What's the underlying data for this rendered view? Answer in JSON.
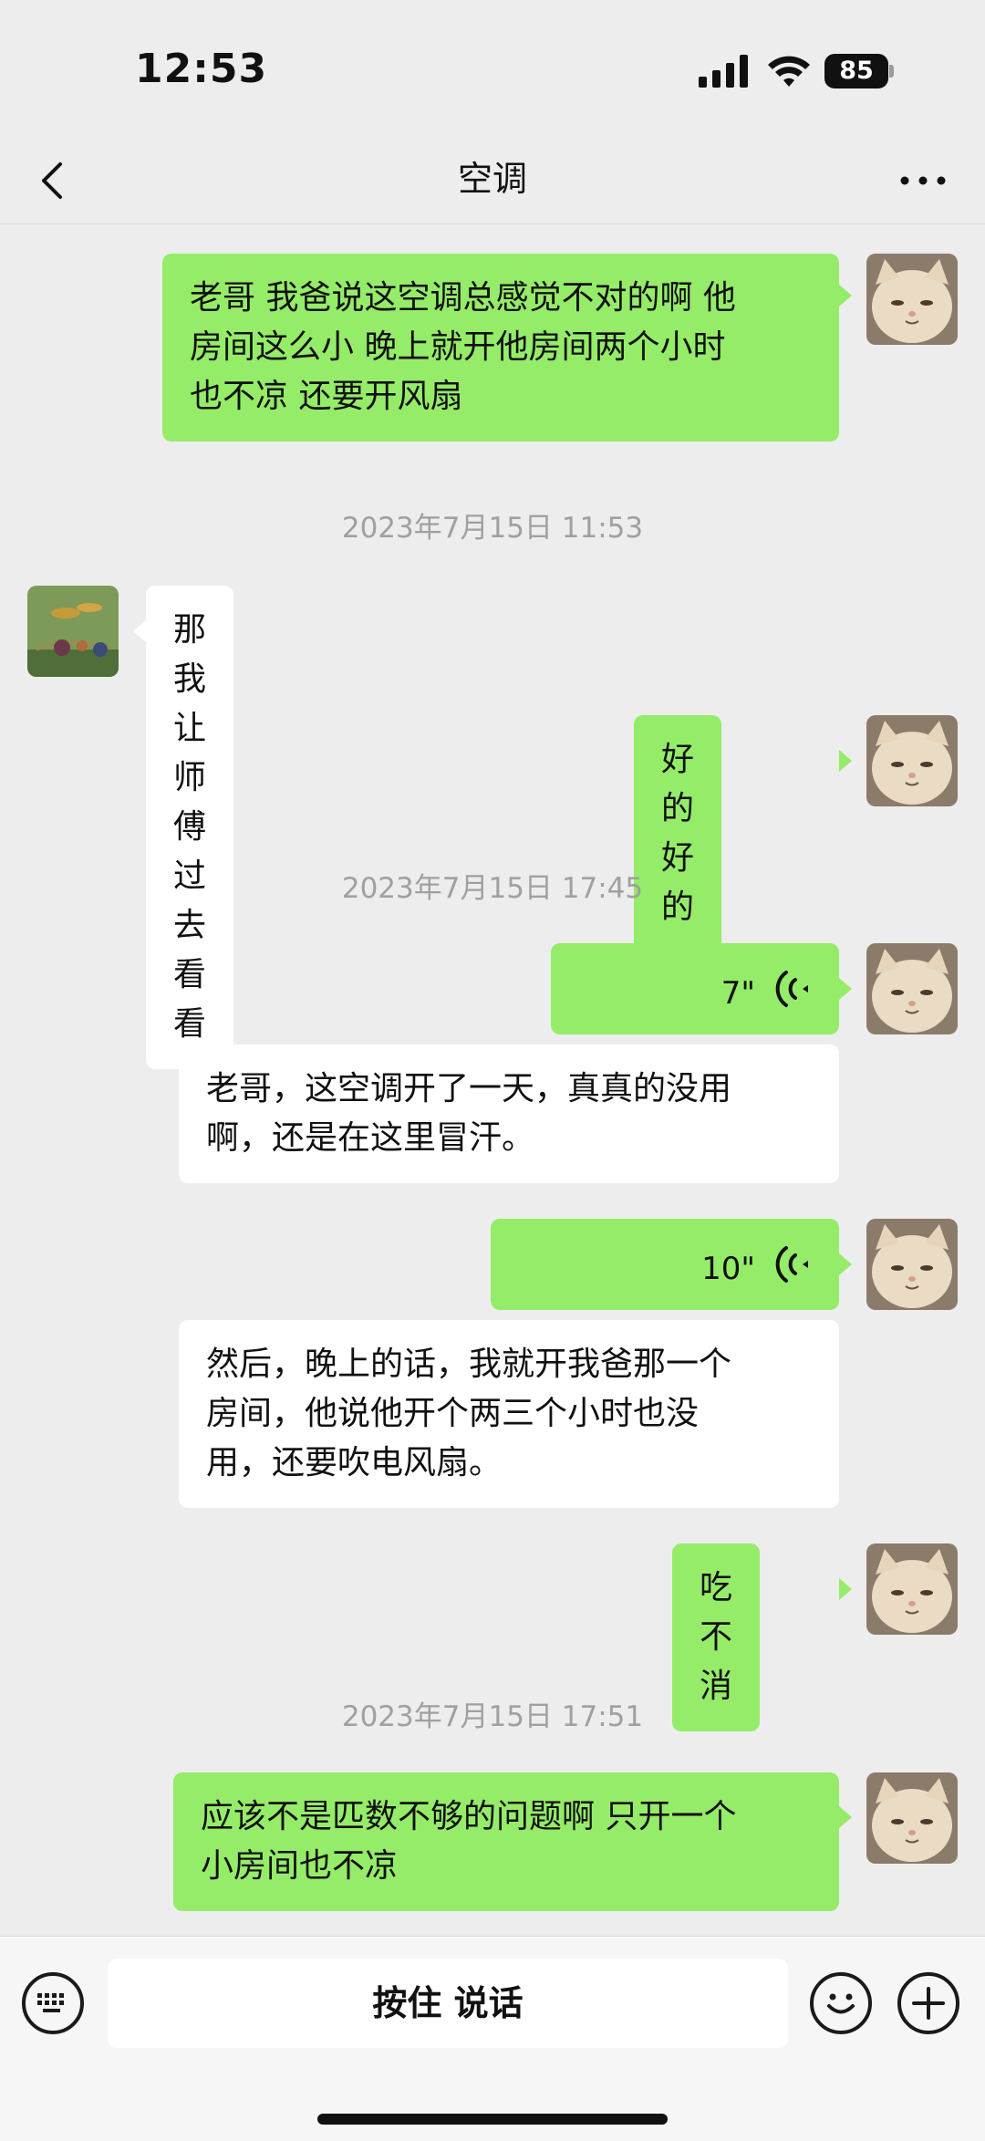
{
  "status_bar": {
    "time": "12:53",
    "battery": "85"
  },
  "nav": {
    "title": "空调",
    "back_icon": "chevron-left-icon",
    "more_icon": "more-dots-icon"
  },
  "messages": [
    {
      "type": "text",
      "side": "right",
      "lines": [
        "老哥 我爸说这空调总感觉不对的啊 他",
        "房间这么小 晚上就开他房间两个小时",
        "也不凉 还要开风扇"
      ]
    },
    {
      "type": "timestamp",
      "text": "2023年7月15日 11:53"
    },
    {
      "type": "text",
      "side": "left",
      "lines": [
        "那我让师傅过去看看"
      ]
    },
    {
      "type": "text",
      "side": "right",
      "lines": [
        "好的好的"
      ]
    },
    {
      "type": "timestamp",
      "text": "2023年7月15日 17:45"
    },
    {
      "type": "voice",
      "side": "right",
      "duration": "7\""
    },
    {
      "type": "transcript",
      "lines": [
        "老哥，这空调开了一天，真真的没用",
        "啊，还是在这里冒汗。"
      ]
    },
    {
      "type": "voice",
      "side": "right",
      "duration": "10\""
    },
    {
      "type": "transcript",
      "lines": [
        "然后，晚上的话，我就开我爸那一个",
        "房间，他说他开个两三个小时也没",
        "用，还要吹电风扇。"
      ]
    },
    {
      "type": "text",
      "side": "right",
      "lines": [
        "吃不消"
      ]
    },
    {
      "type": "timestamp",
      "text": "2023年7月15日 17:51"
    },
    {
      "type": "text",
      "side": "right",
      "lines": [
        "应该不是匹数不够的问题啊 只开一个",
        "小房间也不凉"
      ]
    }
  ],
  "input_bar": {
    "hold_to_talk": "按住 说话",
    "keyboard_icon": "keyboard-icon",
    "emoji_icon": "emoji-icon",
    "plus_icon": "plus-icon"
  },
  "colors": {
    "my_bubble": "#95ec69",
    "their_bubble": "#ffffff",
    "background": "#ededed"
  }
}
